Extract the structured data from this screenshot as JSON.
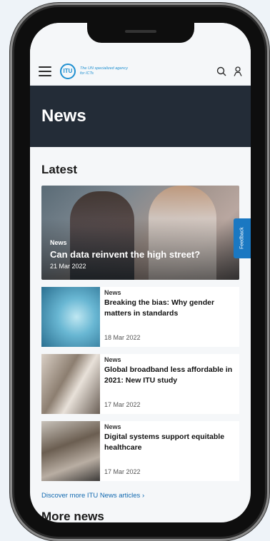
{
  "header": {
    "logo_text": "ITU",
    "tagline": "The UN specialized agency for ICTs",
    "search_icon": "search-icon",
    "user_icon": "user-icon",
    "menu_icon": "hamburger-menu-icon"
  },
  "banner": {
    "title": "News"
  },
  "latest": {
    "heading": "Latest",
    "featured": {
      "category": "News",
      "title": "Can data reinvent the high street?",
      "date": "21 Mar 2022"
    },
    "items": [
      {
        "category": "News",
        "title": "Breaking the bias: Why gender matters in standards",
        "date": "18 Mar 2022"
      },
      {
        "category": "News",
        "title": "Global broadband less affordable in 2021: New ITU study",
        "date": "17 Mar 2022"
      },
      {
        "category": "News",
        "title": "Digital systems support equitable healthcare",
        "date": "17 Mar 2022"
      }
    ],
    "discover_link": "Discover more ITU News articles ›"
  },
  "more_news": {
    "heading": "More news"
  },
  "feedback_tab": {
    "label": "Feedback"
  },
  "colors": {
    "banner_bg": "#232c37",
    "link": "#1169b0",
    "feedback_bg": "#1a78c2",
    "brand": "#1e8fd0"
  }
}
